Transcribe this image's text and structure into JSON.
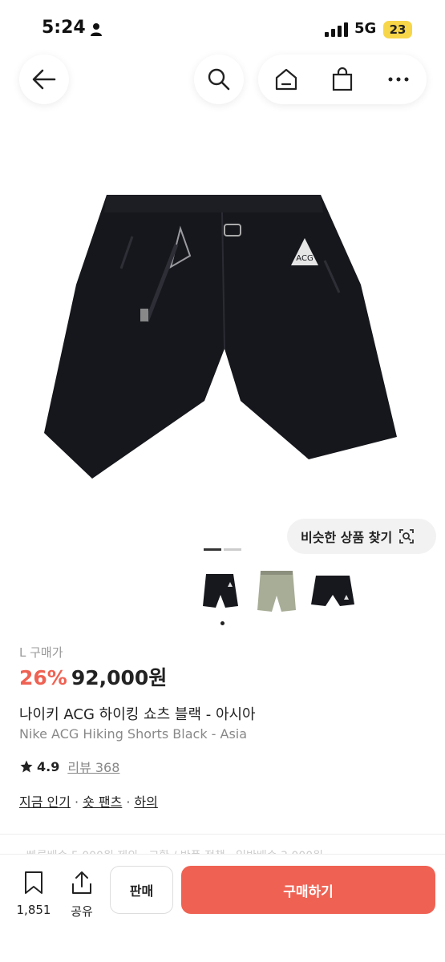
{
  "status": {
    "time": "5:24",
    "network": "5G",
    "battery": "23"
  },
  "product": {
    "size_label": "L 구매가",
    "discount": "26%",
    "price": "92,000원",
    "name_ko": "나이키 ACG 하이킹 쇼츠 블랙 - 아시아",
    "name_en": "Nike ACG Hiking Shorts Black - Asia",
    "rating": "4.9",
    "review_label": "리뷰 368"
  },
  "similar_button": "비슷한 상품 찾기",
  "tags": [
    "지금 인기",
    "숏 팬츠",
    "하의"
  ],
  "faded_text": "· 빠른배송 5,000원 제외 · 교환 / 반품 정책 · 일반배송 3,000원",
  "bottom": {
    "bookmark_count": "1,851",
    "share_label": "공유",
    "sell_label": "판매",
    "buy_label": "구매하기"
  },
  "colors": {
    "accent": "#ef6253"
  }
}
